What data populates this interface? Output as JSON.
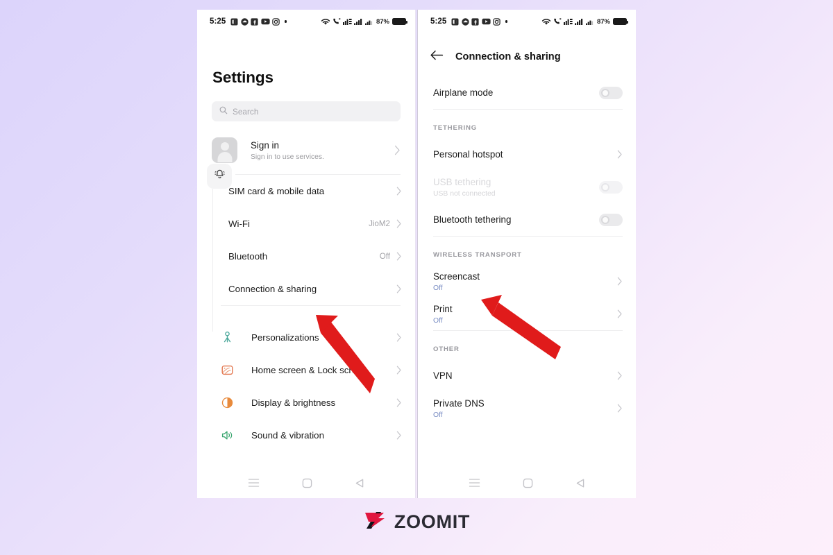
{
  "background": {
    "from": "#dcd4fb",
    "to": "#fdeffb"
  },
  "brand": {
    "name": "ZOOMIT",
    "mark_color": "#e1173f"
  },
  "status_bar": {
    "time": "5:25",
    "battery_percent": "87%",
    "left_icons": [
      "notes-icon",
      "cloud-icon",
      "facebook-icon",
      "youtube-icon",
      "instagram-icon",
      "more-dot-icon"
    ],
    "right_icons": [
      "wifi-icon",
      "call-icon",
      "signal-data-icon",
      "signal-bars-1-icon",
      "signal-bars-2-icon"
    ]
  },
  "left_phone": {
    "title": "Settings",
    "search": {
      "placeholder": "Search",
      "icon": "search-icon"
    },
    "account": {
      "title": "Sign in",
      "subtitle": "Sign in to use services.",
      "avatar": "person-avatar",
      "chevron": "chevron-right-icon"
    },
    "floating_notification": {
      "icon": "bell-icon"
    },
    "group_network": [
      {
        "label": "SIM card & mobile data",
        "value": "",
        "icon": ""
      },
      {
        "label": "Wi-Fi",
        "value": "JioM2",
        "icon": ""
      },
      {
        "label": "Bluetooth",
        "value": "Off",
        "icon": ""
      },
      {
        "label": "Connection & sharing",
        "value": "",
        "icon": ""
      }
    ],
    "group_system": [
      {
        "label": "Personalizations",
        "icon": "personalizations-icon",
        "color": "#4aa79a"
      },
      {
        "label": "Home screen & Lock screen",
        "icon": "home-lock-screen-icon",
        "color": "#e2734a"
      },
      {
        "label": "Display & brightness",
        "icon": "display-brightness-icon",
        "color": "#e88a3c"
      },
      {
        "label": "Sound & vibration",
        "icon": "sound-vibration-icon",
        "color": "#3aa66f"
      }
    ]
  },
  "right_phone": {
    "appbar": {
      "back_icon": "arrow-left-icon",
      "title": "Connection & sharing"
    },
    "top_item": {
      "label": "Airplane mode",
      "toggle_state": "off"
    },
    "sections": [
      {
        "header": "TETHERING",
        "items": [
          {
            "label": "Personal hotspot",
            "sub": "",
            "control": "chevron",
            "disabled": false
          },
          {
            "label": "USB tethering",
            "sub": "USB not connected",
            "control": "toggle",
            "toggle_state": "off",
            "disabled": true
          },
          {
            "label": "Bluetooth tethering",
            "sub": "",
            "control": "toggle",
            "toggle_state": "off",
            "disabled": false
          }
        ]
      },
      {
        "header": "WIRELESS TRANSPORT",
        "items": [
          {
            "label": "Screencast",
            "sub": "Off",
            "control": "chevron",
            "disabled": false
          },
          {
            "label": "Print",
            "sub": "Off",
            "control": "chevron",
            "disabled": false
          }
        ]
      },
      {
        "header": "OTHER",
        "items": [
          {
            "label": "VPN",
            "sub": "",
            "control": "chevron",
            "disabled": false
          },
          {
            "label": "Private DNS",
            "sub": "Off",
            "control": "chevron",
            "disabled": false
          }
        ]
      }
    ]
  },
  "nav_bar": {
    "recents": "recents-icon",
    "home": "home-icon",
    "back": "back-icon"
  },
  "annotations": {
    "arrow_color": "#e01b1b",
    "arrows": [
      {
        "name": "arrow-to-connection-sharing",
        "points_at": "Connection & sharing"
      },
      {
        "name": "arrow-to-screencast",
        "points_at": "Screencast"
      }
    ]
  }
}
